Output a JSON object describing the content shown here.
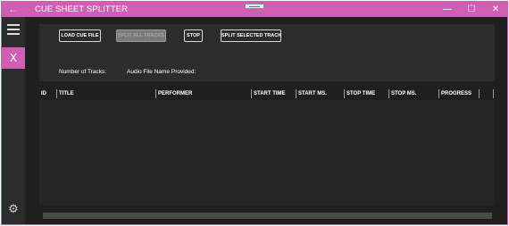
{
  "window": {
    "title": "CUE SHEET SPLITTER",
    "back_glyph": "←",
    "minimize_glyph": "—",
    "maximize_glyph": "☐",
    "close_glyph": "✕",
    "accent_color": "#d05fb4"
  },
  "sidebar": {
    "menu_icon": "hamburger-icon",
    "selected_item_glyph": "X",
    "settings_icon": "gear-icon"
  },
  "toolbar": {
    "load_label": "LOAD CUE FILE",
    "split_all_label": "SPLIT ALL TRACKS",
    "stop_label": "STOP",
    "split_selected_label": "SPLIT SELECTED TRACK"
  },
  "info": {
    "track_count_label": "Number of Tracks:",
    "audio_file_label": "Audio File Name Provided:"
  },
  "table": {
    "columns": [
      "ID",
      "TITLE",
      "PERFORMER",
      "START TIME",
      "START MS.",
      "STOP TIME",
      "STOP MS.",
      "PROGRESS"
    ],
    "rows": []
  }
}
